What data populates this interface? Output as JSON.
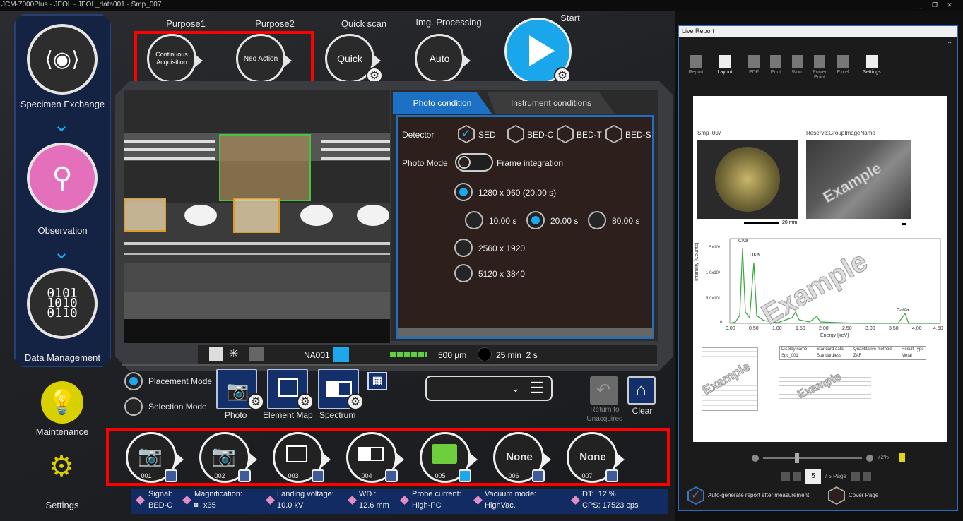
{
  "title_bar": {
    "text": "JCM-7000Plus - JEOL - JEOL_data001 - Smp_007"
  },
  "sidebar": {
    "items": [
      {
        "label": "Specimen Exchange"
      },
      {
        "label": "Observation"
      },
      {
        "label": "Data Management"
      }
    ],
    "maintenance": "Maintenance",
    "settings": "Settings"
  },
  "top": {
    "purpose1": {
      "label": "Purpose1",
      "value": "Continuous Acquisition"
    },
    "purpose2": {
      "label": "Purpose2",
      "value": "Neo Action"
    },
    "quickscan": {
      "label": "Quick scan",
      "value": "Quick"
    },
    "imgproc": {
      "label": "Img. Processing",
      "value": "Auto"
    },
    "start": {
      "label": "Start"
    }
  },
  "panel": {
    "tabs": [
      "Photo condition",
      "Instrument conditions"
    ],
    "detector_label": "Detector",
    "detectors": [
      "SED",
      "BED-C",
      "BED-T",
      "BED-S"
    ],
    "photo_mode_label": "Photo Mode",
    "photo_mode_value": "Frame integration",
    "res1": "1280 x 960 (20.00 s)",
    "times": [
      "10.00 s",
      "20.00 s",
      "80.00 s"
    ],
    "res2": "2560 x 1920",
    "res3": "5120 x 3840"
  },
  "status": {
    "name": "NA001",
    "scale": "500 µm",
    "time": "25 min  2 s"
  },
  "modes": {
    "placement": "Placement Mode",
    "selection": "Selection Mode"
  },
  "capture": {
    "photo": "Photo",
    "element_map": "Element Map",
    "spectrum": "Spectrum",
    "return": "Return to Unacquired",
    "clear": "Clear"
  },
  "slots": [
    {
      "num": "001",
      "label": ""
    },
    {
      "num": "002",
      "label": ""
    },
    {
      "num": "003",
      "label": ""
    },
    {
      "num": "004",
      "label": ""
    },
    {
      "num": "005",
      "label": ""
    },
    {
      "num": "006",
      "label": "None"
    },
    {
      "num": "007",
      "label": "None"
    }
  ],
  "info": [
    {
      "label": "Signal:",
      "value": "BED-C"
    },
    {
      "label": "Magnification:",
      "value": "x35"
    },
    {
      "label": "Landing voltage:",
      "value": "10.0 kV"
    },
    {
      "label": "WD :",
      "value": "12.6 mm"
    },
    {
      "label": "Probe current:",
      "value": "High-PC"
    },
    {
      "label": "Vacuum mode:",
      "value": "HighVac."
    },
    {
      "label": "DT:  12 %",
      "value": "CPS: 17523 cps"
    }
  ],
  "live_report": {
    "title": "Live Report",
    "toolbar": [
      "Report",
      "Layout",
      "PDF",
      "Print",
      "Word",
      "Power Point",
      "Excel",
      "Settings"
    ],
    "img1_caption": "Smp_007",
    "img2_caption": "Reserve:GroupImageName",
    "scale_caption": "20 mm",
    "watermark": "Example",
    "spectrum": {
      "ylabel": "Intensity [Counts]",
      "xlabel": "Energy [keV]",
      "xticks": [
        "0.00",
        "0.50",
        "1.00",
        "1.50",
        "2.00",
        "2.50",
        "3.00",
        "3.50",
        "4.00",
        "4.50"
      ],
      "yticks": [
        "1.5x10³",
        "1.0x10³",
        "5.0x10²",
        "0"
      ],
      "peaks": [
        "CKa",
        "OKa",
        "CaKa"
      ]
    },
    "table_headers": [
      "Display name",
      "Standard data",
      "Quantitative method",
      "Result Type"
    ],
    "table_row": [
      "Spc_001",
      "Standardless",
      "ZAF",
      "Metal"
    ],
    "zoom": "72%",
    "page": "5",
    "page_total": "/ 5 Page",
    "auto_generate": "Auto-generate report after measurement",
    "cover_page": "Cover Page"
  },
  "colors": {
    "accent": "#1ea7ea",
    "red_highlight": "#ff0000",
    "sidebar_bg": "#142244",
    "infobar": "#122c63",
    "green": "#6dcf3b"
  }
}
